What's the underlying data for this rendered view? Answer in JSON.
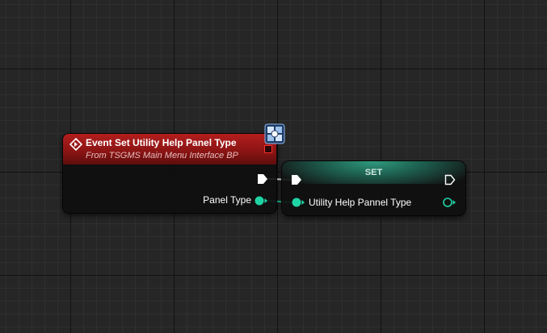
{
  "event_node": {
    "title": "Event Set Utility Help Panel Type",
    "subtitle": "From TSGMS Main Menu Interface BP",
    "output_pin_label": "Panel Type",
    "header_color": "#a01b1b",
    "icons": [
      "event-icon",
      "interface-message-icon",
      "delegate-pin-icon",
      "exec-out-pin-icon",
      "data-out-pin-icon"
    ]
  },
  "set_node": {
    "title": "SET",
    "input_pin_label": "Utility Help Pannel Type",
    "header_color": "#2a8c72",
    "icons": [
      "exec-in-pin-icon",
      "exec-out-pin-icon",
      "data-in-pin-icon",
      "data-out-pin-icon"
    ]
  },
  "colors": {
    "graph_background": "#262626",
    "exec_wire": "#ffffff",
    "data_wire": "#1fd4a4"
  }
}
